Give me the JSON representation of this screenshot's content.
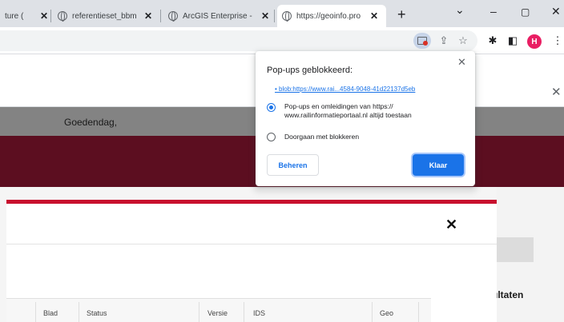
{
  "tabs": [
    {
      "label": "ture ("
    },
    {
      "label": "referentieset_bbm"
    },
    {
      "label": "ArcGIS Enterprise -"
    },
    {
      "label": "https://geoinfo.pro"
    }
  ],
  "window_controls": {
    "minimize": "–",
    "maximize": "▢",
    "close": "✕",
    "dropdown": "⌄"
  },
  "toolbar": {
    "avatar_letter": "H"
  },
  "page": {
    "greeting": "Goedendag,",
    "side_results": "ultaten",
    "table_headers": [
      "Blad",
      "Status",
      "Versie",
      "IDS",
      "Geo"
    ]
  },
  "popup_bubble": {
    "title": "Pop-ups geblokkeerd:",
    "link": "• blob:https://www.rai...4584-9048-41d22137d5eb",
    "option_allow": "Pop-ups en omleidingen van https://\nwww.railinformatieportaal.nl altijd toestaan",
    "option_block": "Doorgaan met blokkeren",
    "manage_label": "Beheren",
    "done_label": "Klaar"
  },
  "colors": {
    "accent_blue": "#1a73e8",
    "brand_dark_red": "#5c0e20",
    "brand_red": "#c8102e",
    "avatar_pink": "#e91e63"
  }
}
